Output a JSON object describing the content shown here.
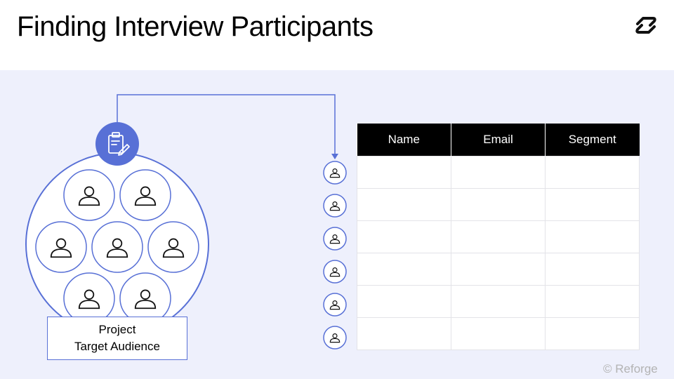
{
  "title": "Finding Interview Participants",
  "audience": {
    "line1": "Project",
    "line2": "Target Audience"
  },
  "table": {
    "headers": [
      "Name",
      "Email",
      "Segment"
    ],
    "rows": 6
  },
  "credit": "© Reforge",
  "colors": {
    "accent": "#5870d6",
    "panel": "#eef0fc",
    "header_bg": "#000000"
  },
  "icons": {
    "source": "clipboard-edit-icon",
    "person": "person-icon",
    "brand": "reforge-logo-icon"
  }
}
